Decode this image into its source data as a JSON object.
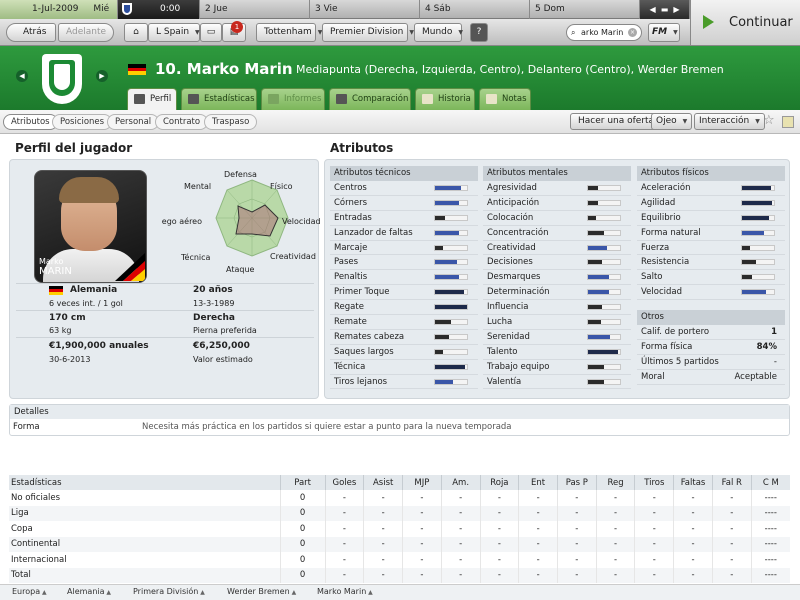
{
  "topbar": {
    "date": "1-Jul-2009",
    "day": "Mié",
    "score": "0:00",
    "days": [
      "2 Jue",
      "3 Vie",
      "4 Sáb",
      "5 Dom"
    ],
    "continue_label": "Continuar"
  },
  "nav": {
    "back": "Atrás",
    "forward": "Adelante",
    "country": "L Spain",
    "club": "Tottenham",
    "league": "Premier Division",
    "world": "Mundo",
    "help": "?",
    "search_value": "arko Marin",
    "fm_menu": "FM",
    "notification_count": "1"
  },
  "player": {
    "number_name": "10. Marko Marin",
    "description": "Mediapunta (Derecha, Izquierda, Centro), Delantero (Centro), Werder Bremen",
    "flag_colors": [
      "#000000",
      "#dd0000",
      "#ffce00"
    ]
  },
  "tabs": [
    {
      "label": "Perfil",
      "active": true
    },
    {
      "label": "Estadísticas"
    },
    {
      "label": "Informes"
    },
    {
      "label": "Comparación"
    },
    {
      "label": "Historia"
    },
    {
      "label": "Notas"
    }
  ],
  "subtabs": [
    "Atributos",
    "Posiciones",
    "Personal",
    "Contrato",
    "Traspaso"
  ],
  "actions": {
    "offer": "Hacer una oferta",
    "scout": "Ojeo",
    "interact": "Interacción"
  },
  "profile": {
    "title": "Perfil del jugador",
    "photo_first": "Marko",
    "photo_last": "MARIN",
    "radar_labels": [
      "Defensa",
      "Físico",
      "Velocidad",
      "Creatividad",
      "Ataque",
      "Técnica",
      "Juego aéreo",
      "Mental"
    ],
    "nationality": "Alemania",
    "caps": "6 veces int. / 1 gol",
    "age": "20 años",
    "dob": "13-3-1989",
    "height": "170 cm",
    "weight": "63 kg",
    "foot": "Derecha",
    "foot_label": "Pierna preferida",
    "wage": "€1,900,000 anuales",
    "contract_end": "30-6-2013",
    "value": "€6,250,000",
    "value_label": "Valor estimado"
  },
  "attributes": {
    "title": "Atributos",
    "technical_title": "Atributos técnicos",
    "technical": [
      {
        "name": "Centros",
        "level": 0.8
      },
      {
        "name": "Córners",
        "level": 0.75
      },
      {
        "name": "Entradas",
        "level": 0.3
      },
      {
        "name": "Lanzador de faltas",
        "level": 0.75
      },
      {
        "name": "Marcaje",
        "level": 0.25
      },
      {
        "name": "Pases",
        "level": 0.7
      },
      {
        "name": "Penaltis",
        "level": 0.75
      },
      {
        "name": "Primer Toque",
        "level": 0.9
      },
      {
        "name": "Regate",
        "level": 1.0
      },
      {
        "name": "Remate",
        "level": 0.5
      },
      {
        "name": "Remates cabeza",
        "level": 0.45
      },
      {
        "name": "Saques largos",
        "level": 0.25
      },
      {
        "name": "Técnica",
        "level": 0.95
      },
      {
        "name": "Tiros lejanos",
        "level": 0.55
      }
    ],
    "mental_title": "Atributos mentales",
    "mental": [
      {
        "name": "Agresividad",
        "level": 0.3
      },
      {
        "name": "Anticipación",
        "level": 0.3
      },
      {
        "name": "Colocación",
        "level": 0.25
      },
      {
        "name": "Concentración",
        "level": 0.5
      },
      {
        "name": "Creatividad",
        "level": 0.6
      },
      {
        "name": "Decisiones",
        "level": 0.45
      },
      {
        "name": "Desmarques",
        "level": 0.65
      },
      {
        "name": "Determinación",
        "level": 0.65
      },
      {
        "name": "Influencia",
        "level": 0.45
      },
      {
        "name": "Lucha",
        "level": 0.4
      },
      {
        "name": "Serenidad",
        "level": 0.7
      },
      {
        "name": "Talento",
        "level": 0.95
      },
      {
        "name": "Trabajo equipo",
        "level": 0.5
      },
      {
        "name": "Valentía",
        "level": 0.5
      }
    ],
    "physical_title": "Atributos físicos",
    "physical": [
      {
        "name": "Aceleración",
        "level": 0.9
      },
      {
        "name": "Agilidad",
        "level": 0.95
      },
      {
        "name": "Equilibrio",
        "level": 0.85
      },
      {
        "name": "Forma natural",
        "level": 0.7
      },
      {
        "name": "Fuerza",
        "level": 0.25
      },
      {
        "name": "Resistencia",
        "level": 0.45
      },
      {
        "name": "Salto",
        "level": 0.3
      },
      {
        "name": "Velocidad",
        "level": 0.75
      }
    ],
    "other_title": "Otros",
    "other": [
      {
        "name": "Calif. de portero",
        "value": "1"
      },
      {
        "name": "Forma física",
        "value": "84%"
      },
      {
        "name": "Últimos 5 partidos",
        "value": "-"
      },
      {
        "name": "Moral",
        "value": "Aceptable"
      }
    ]
  },
  "details": {
    "title": "Detalles",
    "label": "Forma",
    "text": "Necesita más práctica en los partidos si quiere estar a punto para la nueva temporada"
  },
  "stats": {
    "headers": [
      "Estadísticas",
      "Part",
      "Goles",
      "Asist",
      "MJP",
      "Am.",
      "Roja",
      "Ent",
      "Pas P",
      "Reg",
      "Tiros",
      "Faltas",
      "Fal R",
      "C M"
    ],
    "rows": [
      [
        "No oficiales",
        "0",
        "-",
        "-",
        "-",
        "-",
        "-",
        "-",
        "-",
        "-",
        "-",
        "-",
        "-",
        "----"
      ],
      [
        "Liga",
        "0",
        "-",
        "-",
        "-",
        "-",
        "-",
        "-",
        "-",
        "-",
        "-",
        "-",
        "-",
        "----"
      ],
      [
        "Copa",
        "0",
        "-",
        "-",
        "-",
        "-",
        "-",
        "-",
        "-",
        "-",
        "-",
        "-",
        "-",
        "----"
      ],
      [
        "Continental",
        "0",
        "-",
        "-",
        "-",
        "-",
        "-",
        "-",
        "-",
        "-",
        "-",
        "-",
        "-",
        "----"
      ],
      [
        "Internacional",
        "0",
        "-",
        "-",
        "-",
        "-",
        "-",
        "-",
        "-",
        "-",
        "-",
        "-",
        "-",
        "----"
      ],
      [
        "Total",
        "0",
        "-",
        "-",
        "-",
        "-",
        "-",
        "-",
        "-",
        "-",
        "-",
        "-",
        "-",
        "----"
      ]
    ]
  },
  "breadcrumbs": [
    "Europa",
    "Alemania",
    "Primera División",
    "Werder Bremen",
    "Marko Marin"
  ]
}
